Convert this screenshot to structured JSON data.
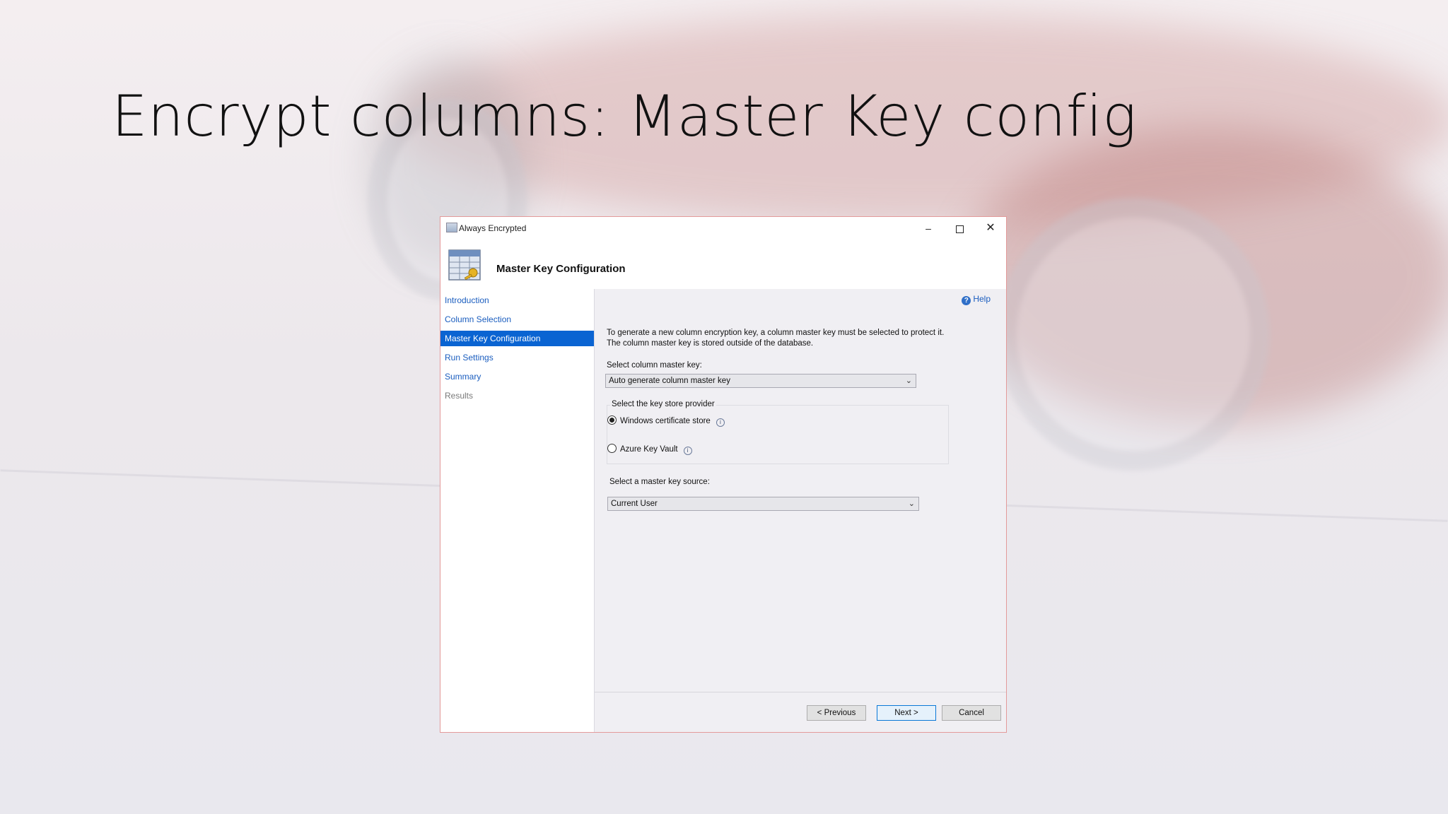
{
  "slide": {
    "title": "Encrypt columns: Master Key config"
  },
  "window": {
    "title": "Always Encrypted",
    "minimize_glyph": "–",
    "close_glyph": "✕"
  },
  "header": {
    "title": "Master Key Configuration"
  },
  "sidebar": {
    "items": [
      {
        "label": "Introduction",
        "state": "link"
      },
      {
        "label": "Column Selection",
        "state": "link"
      },
      {
        "label": "Master Key Configuration",
        "state": "active"
      },
      {
        "label": "Run Settings",
        "state": "link"
      },
      {
        "label": "Summary",
        "state": "link"
      },
      {
        "label": "Results",
        "state": "disabled"
      }
    ]
  },
  "content": {
    "help_label": "Help",
    "description": "To generate a new column encryption key, a column master key must be selected to protect it.  The column master key is stored outside of the database.",
    "select_master_key_label": "Select column master key:",
    "master_key_value": "Auto generate column master key",
    "provider_group_label": "Select the key store provider",
    "providers": [
      {
        "label": "Windows certificate store",
        "checked": true
      },
      {
        "label": "Azure Key Vault",
        "checked": false
      }
    ],
    "source_label": "Select a master key source:",
    "source_value": "Current User"
  },
  "footer": {
    "previous_label": "< Previous",
    "next_label": "Next >",
    "cancel_label": "Cancel"
  },
  "colors": {
    "accent": "#0a64d2",
    "link": "#1a5dbf",
    "dialog_border": "#e39a9a"
  },
  "icons": [
    "window-app-icon",
    "master-key-icon",
    "help-icon",
    "info-icon",
    "chevron-down-icon"
  ]
}
